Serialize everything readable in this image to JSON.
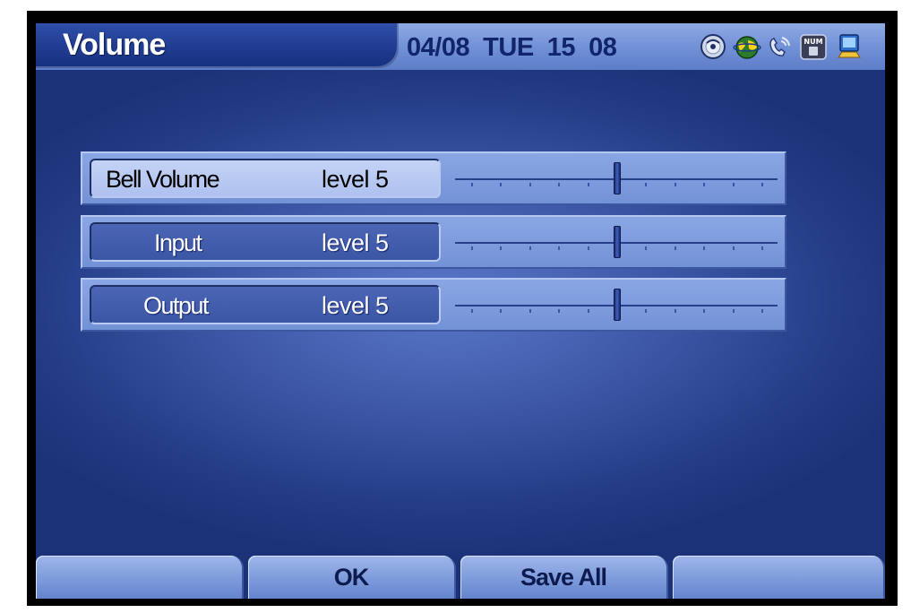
{
  "header": {
    "title": "Volume",
    "datetime": "04/08  TUE  15  08",
    "status_icons": [
      "disc-icon",
      "globe-icon",
      "phone-ring-icon",
      "num-lock-icon",
      "monitor-icon"
    ]
  },
  "volume_settings": [
    {
      "name": "Bell Volume",
      "level_text": "level  5",
      "level": 5,
      "max_level": 11,
      "selected": true
    },
    {
      "name": "Input",
      "level_text": "level  5",
      "level": 5,
      "max_level": 11,
      "selected": false
    },
    {
      "name": "Output",
      "level_text": "level  5",
      "level": 5,
      "max_level": 11,
      "selected": false
    }
  ],
  "softkeys": [
    {
      "label": ""
    },
    {
      "label": "OK"
    },
    {
      "label": "Save  All"
    },
    {
      "label": ""
    }
  ],
  "colors": {
    "background": "#3d57a6",
    "header": "#7a96d8",
    "title_tab": "#1f3a8e",
    "selected_row": "#b9cbf2"
  }
}
